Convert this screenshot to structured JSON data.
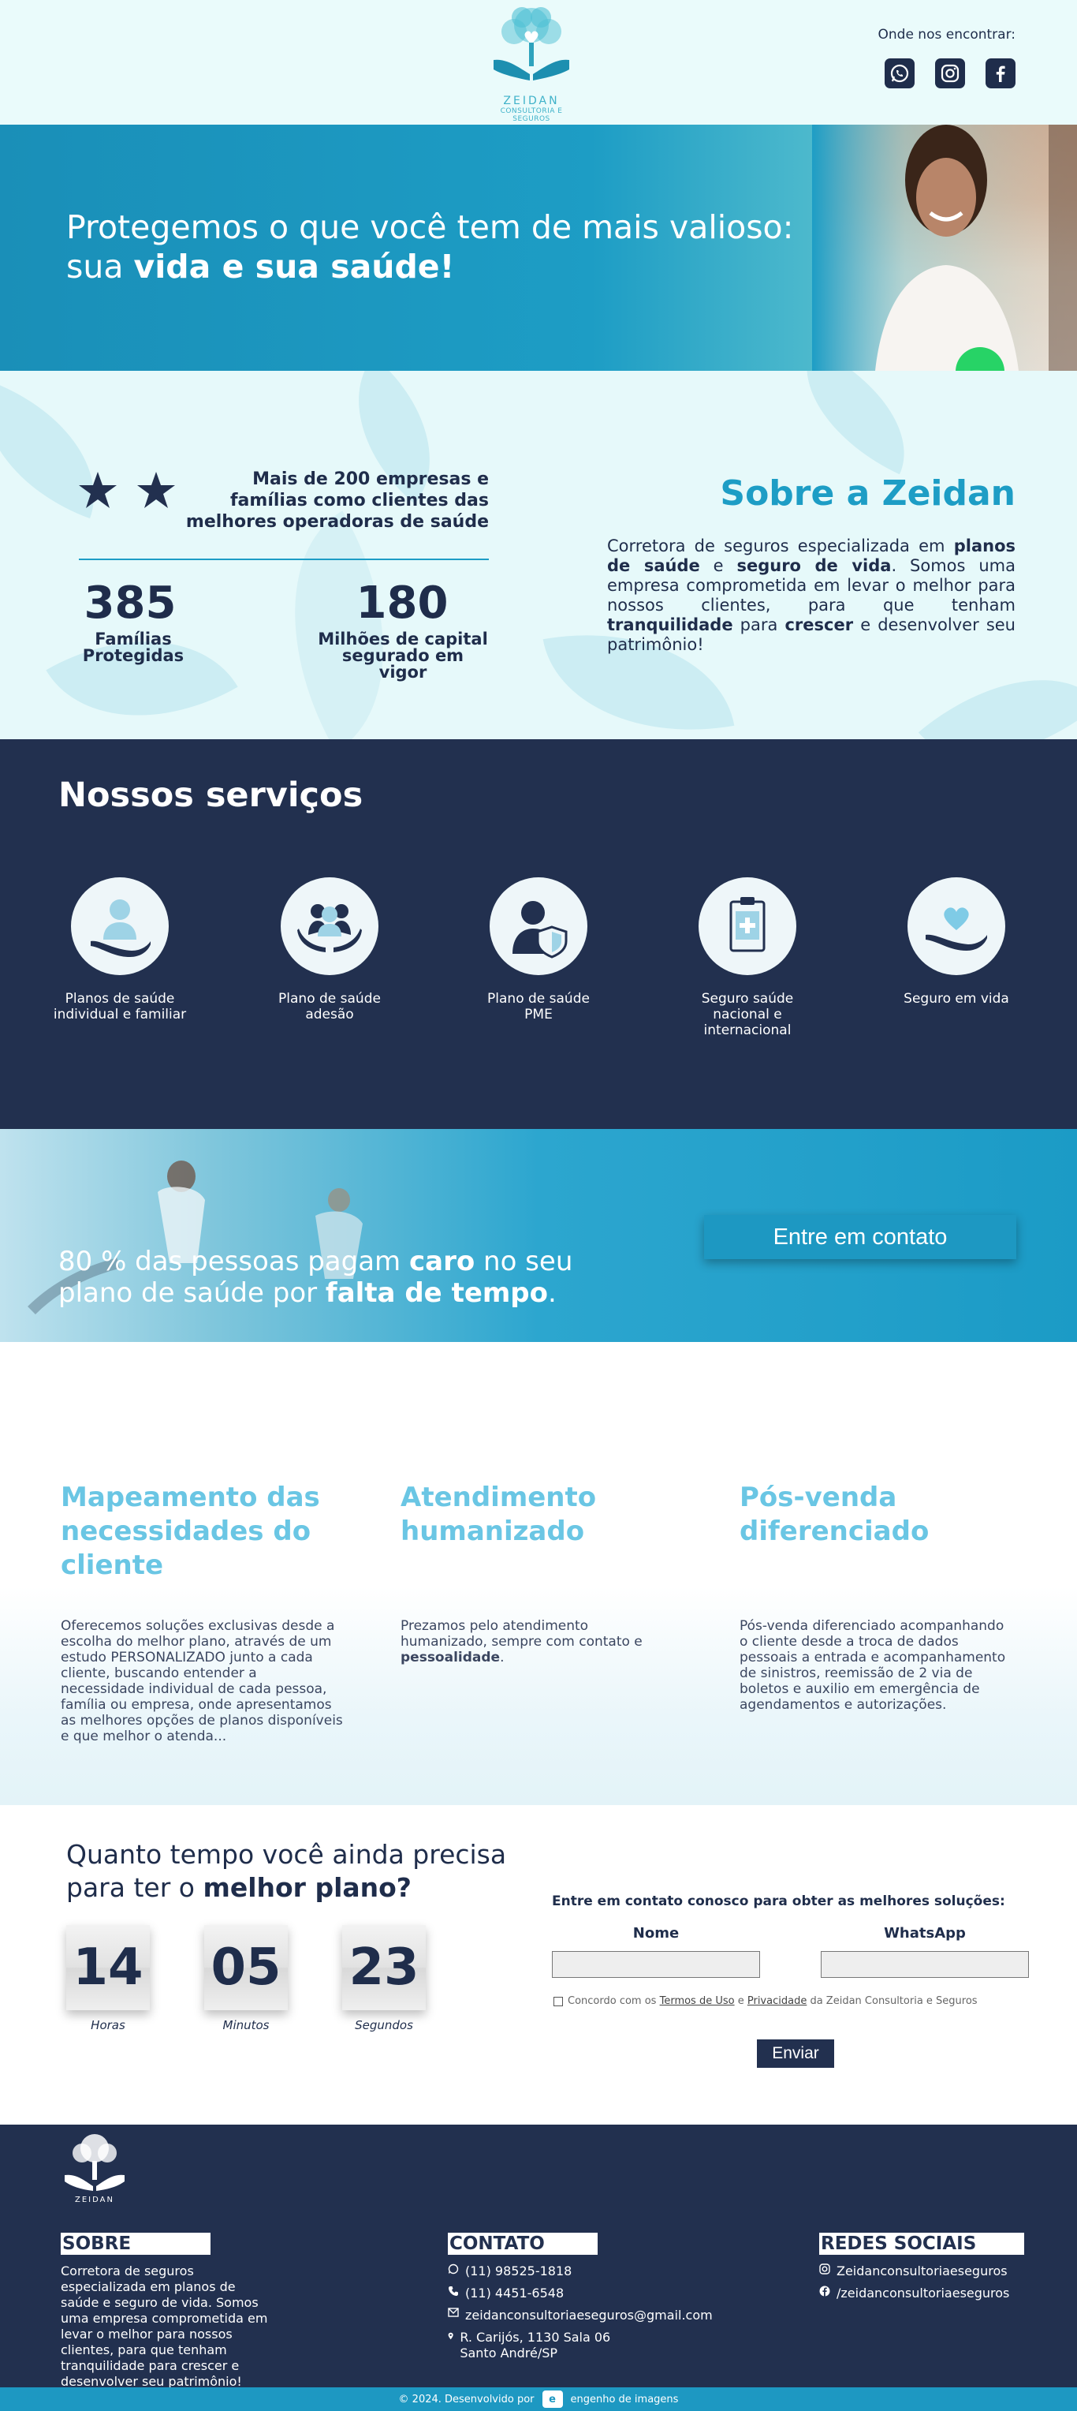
{
  "header": {
    "logo_name": "ZEIDAN",
    "logo_sub": "CONSULTORIA E SEGUROS",
    "find_label": "Onde nos encontrar:",
    "social_icons": [
      "whatsapp-icon",
      "instagram-icon",
      "facebook-icon"
    ]
  },
  "hero": {
    "line1": "Protegemos o que você tem de mais valioso:",
    "line2_prefix": "sua ",
    "line2_bold": "vida e sua saúde!"
  },
  "about": {
    "stat_text": "Mais de 200 empresas e famílias como clientes das melhores operadoras de saúde",
    "stats": [
      {
        "value": "385",
        "label": "Famílias Protegidas"
      },
      {
        "value": "180",
        "label": "Milhões de capital segurado em vigor"
      }
    ],
    "title": "Sobre a Zeidan",
    "description_parts": [
      "Corretora de seguros especializada em ",
      "planos de saúde",
      " e ",
      "seguro de vida",
      ". Somos uma empresa comprometida em levar o melhor para nossos clientes, para que tenham ",
      "tranquilidade",
      " para ",
      "crescer",
      " e desenvolver seu patrimônio!"
    ]
  },
  "services": {
    "title": "Nossos serviços",
    "items": [
      {
        "label": "Planos de saúde individual e familiar",
        "icon": "hand-person-icon"
      },
      {
        "label": "Plano de saúde adesão",
        "icon": "hands-group-icon"
      },
      {
        "label": "Plano de saúde PME",
        "icon": "person-shield-icon"
      },
      {
        "label": "Seguro saúde nacional e internacional",
        "icon": "clipboard-cross-icon"
      },
      {
        "label": "Seguro em vida",
        "icon": "hand-heart-icon"
      }
    ]
  },
  "cta": {
    "text_a": "80 % das pessoas pagam ",
    "text_b": "caro",
    "text_c": " no seu",
    "text_d": "plano de saúde por ",
    "text_e": "falta de tempo",
    "text_f": ".",
    "button": "Entre em contato"
  },
  "features": [
    {
      "title": "Mapeamento das necessidades do cliente",
      "text": "Oferecemos soluções exclusivas desde a escolha do melhor plano, através de um estudo PERSONALIZADO junto a cada cliente, buscando entender a necessidade individual de cada pessoa, família ou empresa, onde apresentamos as melhores opções de planos disponíveis e que melhor o atenda..."
    },
    {
      "title": "Atendimento humanizado",
      "text": "Prezamos pelo atendimento humanizado, sempre com contato e ",
      "text_bold": "pessoalidade",
      "text_end": "."
    },
    {
      "title": "Pós-venda diferenciado",
      "text": "Pós-venda diferenciado acompanhando o cliente desde a troca de dados pessoais a entrada e acompanhamento de sinistros, reemissão de 2 via de boletos e auxilio em emergência de agendamentos e autorizações."
    }
  ],
  "countdown": {
    "title_a": "Quanto tempo você ainda precisa",
    "title_b": "para ter o ",
    "title_bold": "melhor plano?",
    "units": [
      {
        "value": "14",
        "label": "Horas"
      },
      {
        "value": "05",
        "label": "Minutos"
      },
      {
        "value": "23",
        "label": "Segundos"
      }
    ]
  },
  "form": {
    "title": "Entre em contato conosco para obter as melhores soluções:",
    "name_label": "Nome",
    "whatsapp_label": "WhatsApp",
    "terms_a": "Concordo com os ",
    "terms_link1": "Termos de Uso",
    "terms_b": " e ",
    "terms_link2": "Privacidade",
    "terms_c": " da Zeidan Consultoria e Seguros",
    "submit": "Enviar"
  },
  "footer": {
    "about_title": "SOBRE",
    "about_text": "Corretora de seguros especializada em planos de saúde e seguro de vida. Somos uma empresa comprometida em levar o melhor para nossos clientes, para que tenham tranquilidade para crescer e desenvolver seu patrimônio!",
    "contact_title": "CONTATO",
    "phone1": "(11) 98525-1818",
    "phone2": "(11) 4451-6548",
    "email": "zeidanconsultoriaeseguros@gmail.com",
    "address": "R. Carijós, 1130 Sala 06 Santo André/SP",
    "social_title": "REDES SOCIAIS",
    "instagram": "Zeidanconsultoriaeseguros",
    "facebook": "/zeidanconsultoriaeseguros",
    "copyright": "© 2024. Desenvolvido por",
    "dev": "engenho de imagens"
  },
  "colors": {
    "navy": "#22304f",
    "cyan": "#1d9dc5",
    "light_cyan": "#6ac6e4",
    "mint": "#e6f9fa"
  }
}
